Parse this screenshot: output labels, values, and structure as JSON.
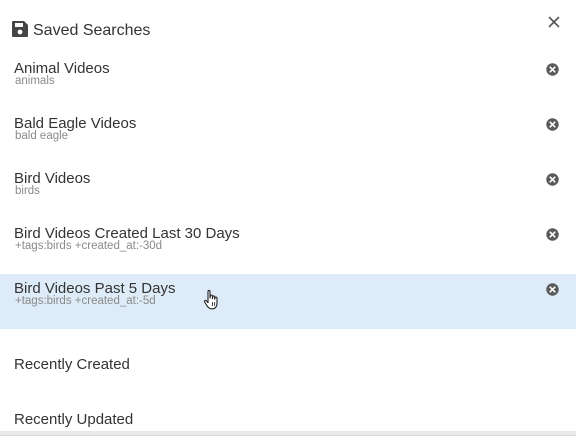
{
  "header": {
    "title": "Saved Searches",
    "icon": "floppy-disk-icon",
    "close_icon": "close-icon"
  },
  "items": [
    {
      "name": "Animal Videos",
      "query": "animals"
    },
    {
      "name": "Bald Eagle Videos",
      "query": "bald eagle"
    },
    {
      "name": "Bird Videos",
      "query": "birds"
    },
    {
      "name": "Bird Videos Created Last 30 Days",
      "query": "+tags:birds +created_at:-30d"
    },
    {
      "name": "Bird Videos Past 5 Days",
      "query": "+tags:birds +created_at:-5d",
      "highlighted": true
    },
    {
      "name": "Recently Created"
    },
    {
      "name": "Recently Updated"
    }
  ],
  "colors": {
    "highlight": "#ddecf8",
    "remove_icon": "#5a5a5a",
    "query_text": "#8a8a8a"
  }
}
